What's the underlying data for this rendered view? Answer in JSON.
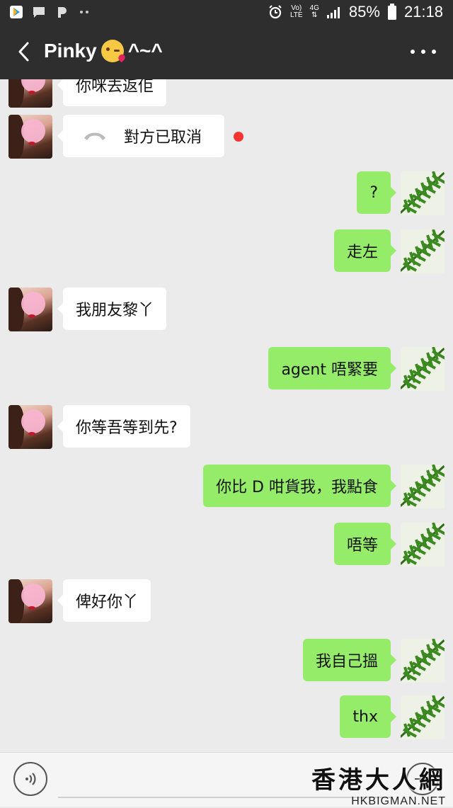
{
  "status_bar": {
    "left_icons": [
      "google-play-icon",
      "message-icon",
      "p-app-icon",
      "more-dots-icon"
    ],
    "right_icons": [
      "alarm-icon",
      "volte-icon",
      "4g-icon",
      "signal-icon",
      "battery-icon"
    ],
    "volte_top": "Vo)",
    "volte_bottom": "LTE",
    "network": "4G",
    "battery": "85%",
    "time": "21:18"
  },
  "header": {
    "back_icon": "back-chevron-icon",
    "title": "Pinky",
    "title_emoji": "kissing-face-emoji",
    "title_suffix": "^~^",
    "menu_icon": "more-horizontal-icon"
  },
  "messages": [
    {
      "from": "her",
      "text": "你咪去返佢"
    },
    {
      "from": "her",
      "type": "call",
      "icon": "phone-hangup-icon",
      "text": "對方已取消",
      "unread": true
    },
    {
      "from": "me",
      "text": "?"
    },
    {
      "from": "me",
      "text": "走左"
    },
    {
      "from": "her",
      "text": "我朋友黎丫"
    },
    {
      "from": "me",
      "text": "agent 唔緊要"
    },
    {
      "from": "her",
      "text": "你等吾等到先?"
    },
    {
      "from": "me",
      "text": "你比 D 咁貨我，我點食"
    },
    {
      "from": "me",
      "text": "唔等"
    },
    {
      "from": "her",
      "text": "俾好你丫"
    },
    {
      "from": "me",
      "text": "我自己搵"
    },
    {
      "from": "me",
      "text": "thx"
    }
  ],
  "input_bar": {
    "voice_icon": "voice-input-icon",
    "plus_icon": "plus-circle-icon"
  },
  "watermark": {
    "title": "香港大人網",
    "url": "HKBIGMAN.NET"
  },
  "colors": {
    "header_bg": "#2e2e2e",
    "chat_bg": "#ebebeb",
    "outgoing_bubble": "#95ec69",
    "incoming_bubble": "#ffffff",
    "unread_dot": "#f43530"
  }
}
